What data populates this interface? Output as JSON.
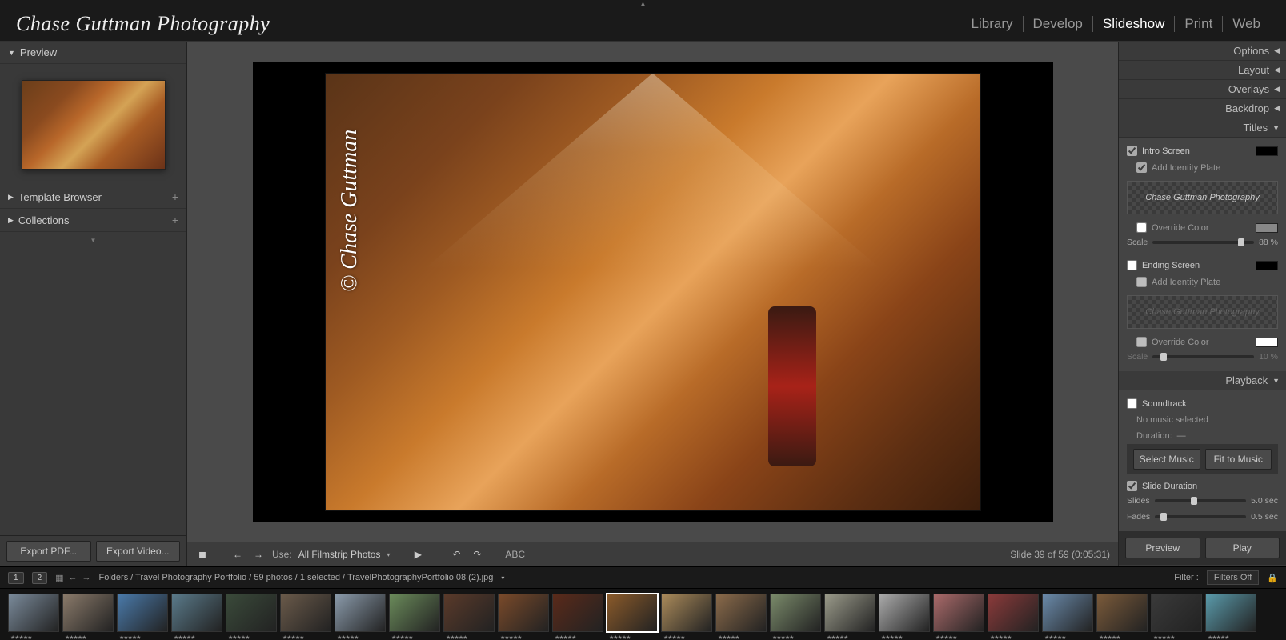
{
  "header": {
    "identity": "Chase Guttman Photography",
    "modules": [
      "Library",
      "Develop",
      "Slideshow",
      "Print",
      "Web"
    ],
    "active_module": "Slideshow"
  },
  "left_panel": {
    "preview_label": "Preview",
    "template_browser_label": "Template Browser",
    "collections_label": "Collections"
  },
  "canvas": {
    "watermark": "© Chase Guttman"
  },
  "toolbar": {
    "use_label": "Use:",
    "use_value": "All Filmstrip Photos",
    "abc": "ABC",
    "slide_info": "Slide 39 of 59 (0:05:31)",
    "export_pdf": "Export PDF...",
    "export_video": "Export Video..."
  },
  "right_panel": {
    "sections": {
      "options": "Options",
      "layout": "Layout",
      "overlays": "Overlays",
      "backdrop": "Backdrop",
      "titles": "Titles",
      "playback": "Playback"
    },
    "titles": {
      "intro_screen": "Intro Screen",
      "add_identity_plate": "Add Identity Plate",
      "identity_text": "Chase Guttman Photography",
      "override_color": "Override Color",
      "scale_label": "Scale",
      "scale_value": "88 %",
      "ending_screen": "Ending Screen",
      "ending_add_identity": "Add Identity Plate",
      "ending_override": "Override Color",
      "ending_scale_value": "10 %"
    },
    "playback": {
      "soundtrack": "Soundtrack",
      "no_music": "No music selected",
      "duration_label": "Duration:",
      "duration_value": "—",
      "select_music": "Select Music",
      "fit_to_music": "Fit to Music",
      "slide_duration": "Slide Duration",
      "slides_label": "Slides",
      "slides_value": "5.0 sec",
      "fades_label": "Fades",
      "fades_value": "0.5 sec"
    },
    "buttons": {
      "preview": "Preview",
      "play": "Play"
    }
  },
  "bottom_bar": {
    "pages": [
      "1",
      "2"
    ],
    "breadcrumb": "Folders / Travel Photography Portfolio / 59 photos / 1 selected / TravelPhotographyPortfolio 08 (2).jpg",
    "filter_label": "Filter :",
    "filter_value": "Filters Off"
  },
  "filmstrip": {
    "count": 23,
    "selected_index": 11,
    "colors": [
      "#7a8a9a",
      "#8a7a6a",
      "#4a7aaa",
      "#5a7a8a",
      "#3a4a3a",
      "#6a5a4a",
      "#8a9aaa",
      "#6a8a5a",
      "#5a3a2a",
      "#7a4a2a",
      "#5a2a1a",
      "#8a5a2a",
      "#aa8a5a",
      "#8a6a4a",
      "#7a8a6a",
      "#9a9a8a",
      "#aaaaaa",
      "#aa6a6a",
      "#8a3a3a",
      "#6a8aaa",
      "#7a5a3a",
      "#3a3a3a",
      "#5a9aaa"
    ]
  }
}
